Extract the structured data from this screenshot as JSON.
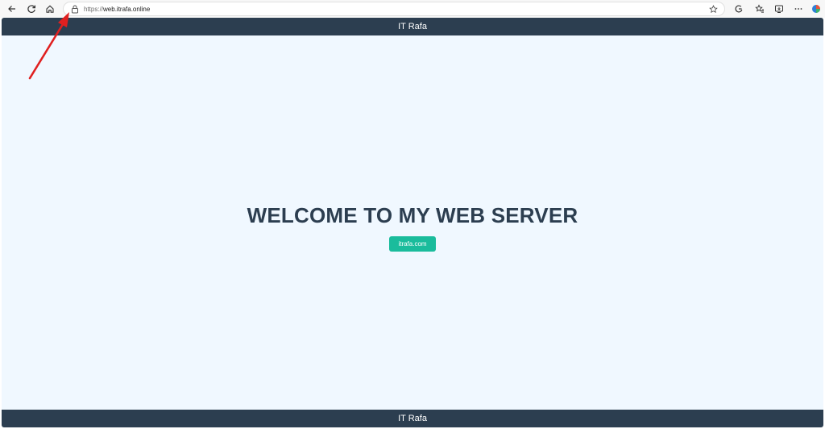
{
  "browser": {
    "url_protocol": "https://",
    "url_host": "web.itrafa.online",
    "icons": [
      "back-icon",
      "reload-icon",
      "home-icon",
      "lock-icon",
      "star-icon",
      "extensions-icon",
      "favorites-icon",
      "collections-icon",
      "more-icon",
      "profile-icon"
    ]
  },
  "site": {
    "header_title": "IT Rafa",
    "hero_title": "WELCOME TO MY WEB SERVER",
    "hero_link": "itrafa.com",
    "footer_title": "IT Rafa"
  },
  "colors": {
    "nav_bg": "#2c3e50",
    "page_bg": "#f0f8ff",
    "accent": "#1abc9c",
    "annotation": "#e02020"
  }
}
